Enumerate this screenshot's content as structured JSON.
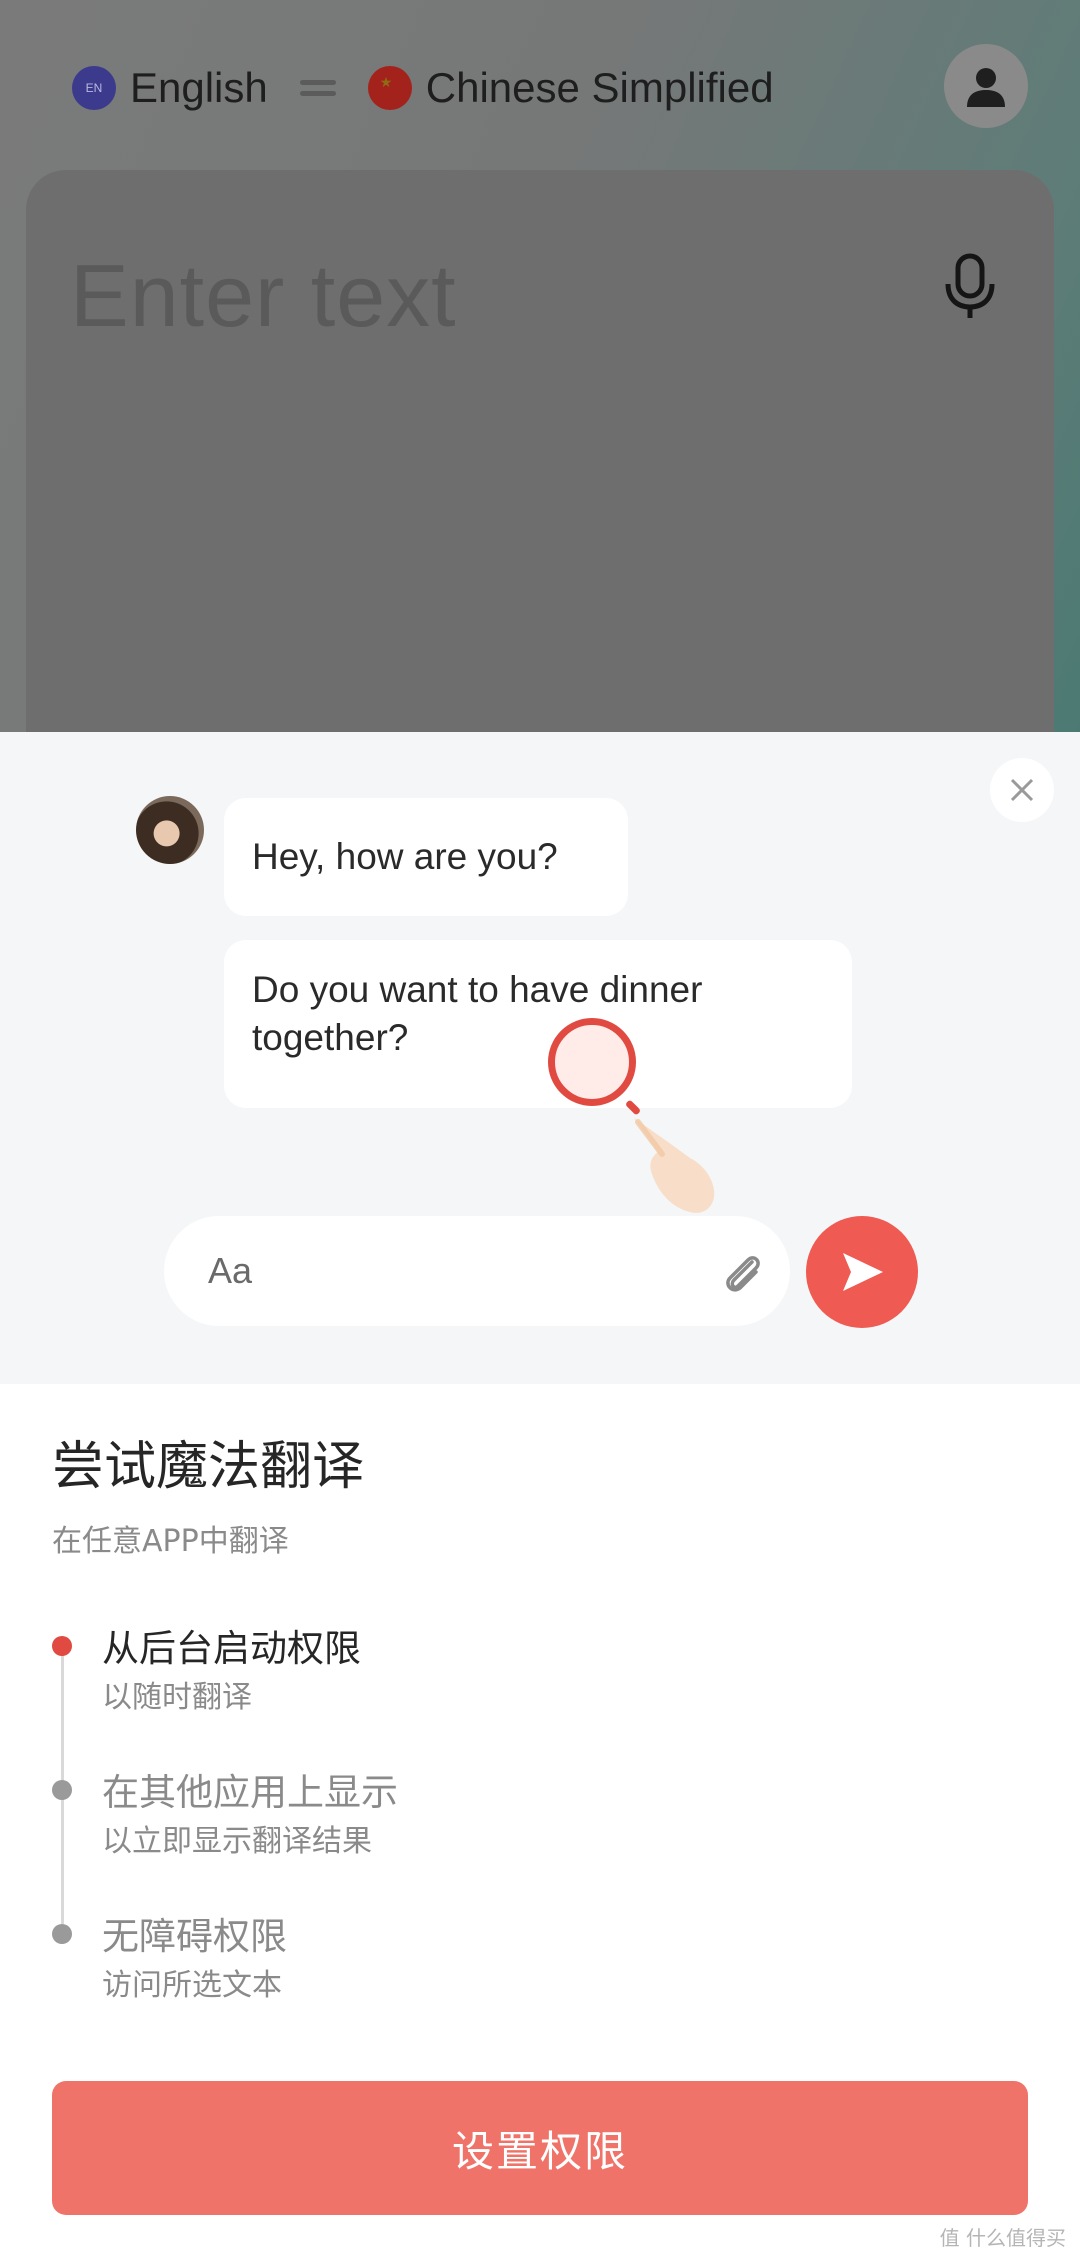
{
  "app": {
    "source_language": "English",
    "target_language": "Chinese Simplified",
    "input_placeholder": "Enter text"
  },
  "demo": {
    "message_1": "Hey, how are you?",
    "message_2": "Do you want to have dinner together?",
    "compose_placeholder": "Aa"
  },
  "sheet": {
    "title": "尝试魔法翻译",
    "subtitle": "在任意APP中翻译",
    "steps": [
      {
        "title": "从后台启动权限",
        "desc": "以随时翻译",
        "active": true
      },
      {
        "title": "在其他应用上显示",
        "desc": "以立即显示翻译结果",
        "active": false
      },
      {
        "title": "无障碍权限",
        "desc": "访问所选文本",
        "active": false
      }
    ],
    "primary_button": "设置权限"
  },
  "watermark": "值 什么值得买",
  "colors": {
    "accent": "#ef5a52",
    "button": "#f0736a",
    "step_active": "#e04a41",
    "step_inactive": "#9a9a9a"
  },
  "icons": [
    "english-flag-icon",
    "china-flag-icon",
    "swap-icon",
    "profile-icon",
    "microphone-icon",
    "close-icon",
    "paperclip-icon",
    "send-icon",
    "magnifier-icon",
    "hand-pointer-icon"
  ]
}
